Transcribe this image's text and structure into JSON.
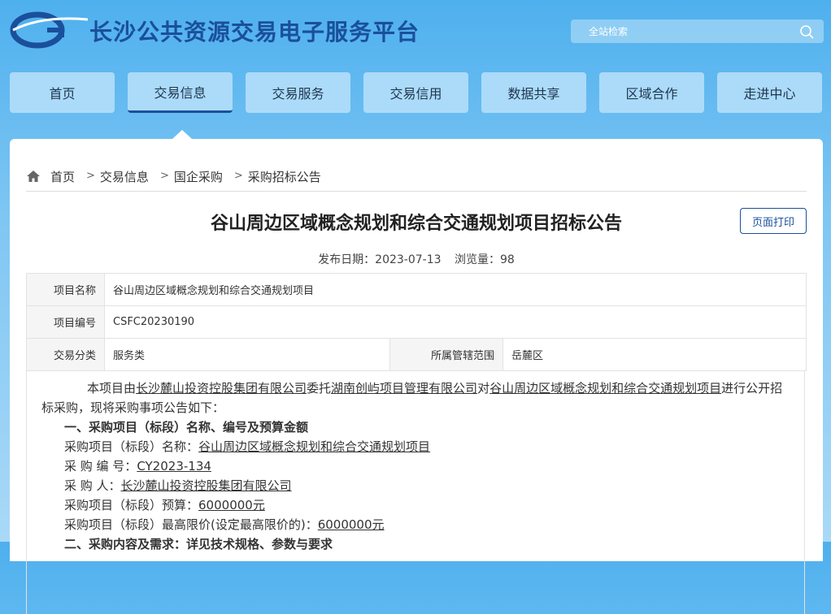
{
  "header": {
    "title": "长沙公共资源交易电子服务平台",
    "search_placeholder": "全站检索"
  },
  "nav": [
    "首页",
    "交易信息",
    "交易服务",
    "交易信用",
    "数据共享",
    "区域合作",
    "走进中心"
  ],
  "breadcrumb": [
    "首页",
    "交易信息",
    "国企采购",
    "采购招标公告"
  ],
  "article": {
    "title": "谷山周边区域概念规划和综合交通规划项目招标公告",
    "print_label": "页面打印",
    "publish_date_label": "发布日期：",
    "publish_date": "2023-07-13",
    "views_label": "浏览量：",
    "views": "98"
  },
  "info": {
    "name_label": "项目名称",
    "name": "谷山周边区域概念规划和综合交通规划项目",
    "code_label": "项目编号",
    "code": "CSFC20230190",
    "type_label": "交易分类",
    "type": "服务类",
    "area_label": "所属管辖范围",
    "area": "岳麓区"
  },
  "body": {
    "p1": "本项目由",
    "owner": "长沙麓山投资控股集团有限公司",
    "p2": "委托",
    "agent": "湖南创屿项目管理有限公司",
    "p3": "对",
    "project": "谷山周边区域概念规划和综合交通规划项目",
    "p4": "进行公开招标采购，现将采购事项公告如下：",
    "section1": "一、采购项目（标段）名称、编号及预算金额",
    "name_label": "采购项目（标段）名称：",
    "name": "谷山周边区域概念规划和综合交通规划项目",
    "code_label": "采 购 编 号：",
    "code": "CY2023-134",
    "buyer_label": "采 购 人：",
    "buyer": "长沙麓山投资控股集团有限公司",
    "budget_label": "采购项目（标段）预算：",
    "budget": "6000000元",
    "max_label": "采购项目（标段）最高限价(设定最高限价的)：",
    "max": "6000000元",
    "section2": "二、采购内容及需求：详见技术规格、参数与要求"
  },
  "colors": {
    "brand": "#1a4f9c",
    "bg": "#4eb0ee"
  }
}
